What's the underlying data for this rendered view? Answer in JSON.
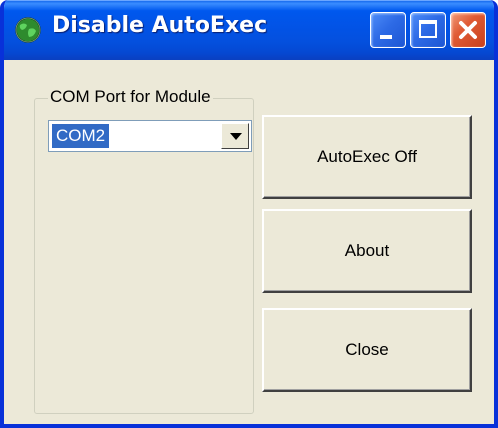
{
  "window": {
    "title": "Disable AutoExec",
    "icon": "globe-icon"
  },
  "titlebar": {
    "minimize_icon": "minimize-icon",
    "maximize_icon": "maximize-icon",
    "close_icon": "close-icon"
  },
  "groupbox": {
    "label": "COM Port for Module"
  },
  "com_port": {
    "selected": "COM2"
  },
  "buttons": {
    "autoexec_off": "AutoExec Off",
    "about": "About",
    "close": "Close"
  },
  "colors": {
    "titlebar": "#0054e3",
    "face": "#ece9d8",
    "selection": "#316ac5",
    "close_button": "#e05b35"
  }
}
